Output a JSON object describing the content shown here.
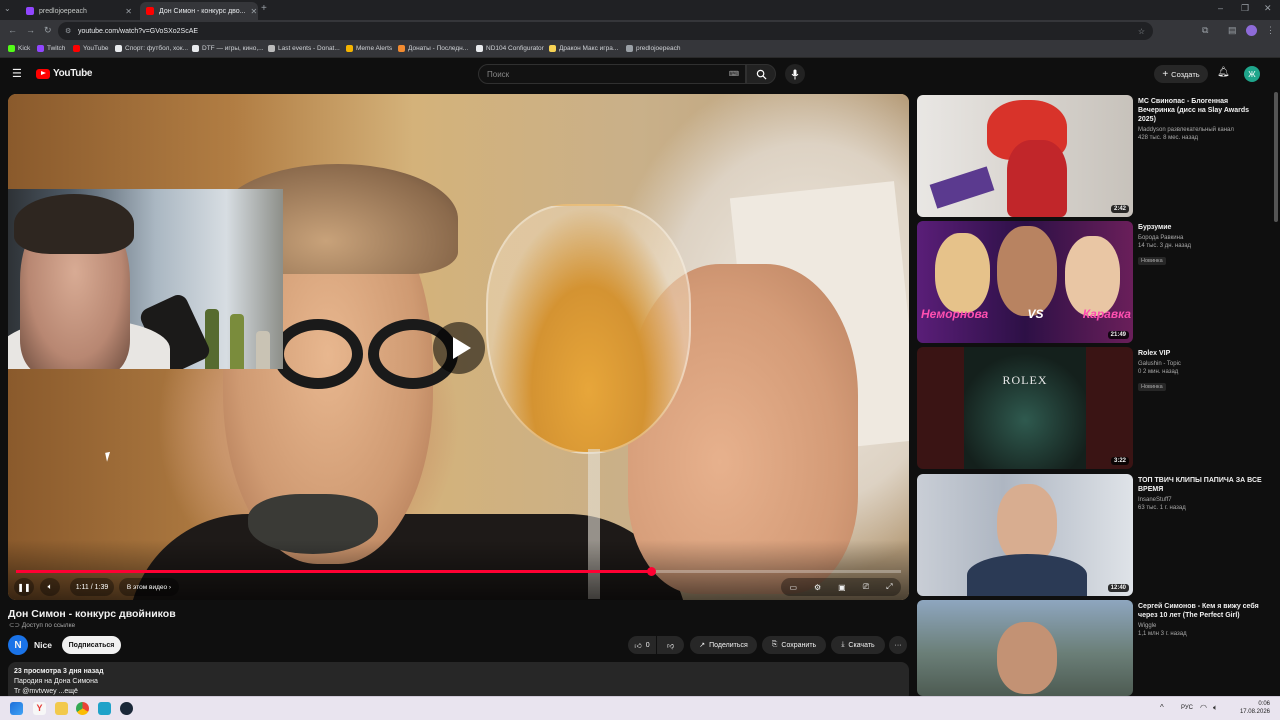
{
  "browser": {
    "tabs": [
      {
        "title": "predlojoepeach",
        "active": false
      },
      {
        "title": "Дон Симон - конкурс дво...",
        "active": true
      }
    ],
    "url": "youtube.com/watch?v=GVoSXo2ScAE",
    "bookmarks": [
      "Kick",
      "Twitch",
      "YouTube",
      "Спорт: футбол, хок...",
      "DTF — игры, кино,...",
      "Last events - Donat...",
      "Meme Alerts",
      "Донаты - Последн...",
      "ND104 Configurator",
      "Дракон Макс игра...",
      "predlojoepeach"
    ]
  },
  "youtube": {
    "logo_text": "YouTube",
    "search_placeholder": "Поиск",
    "create_label": "Создать",
    "user_initial": "Ж"
  },
  "player": {
    "time": "1:11 / 1:39",
    "chapter_label": "В этом видео",
    "progress": 0.718
  },
  "video": {
    "title": "Дон Симон - конкурс двойников",
    "access": "Доступ по ссылке",
    "channel_initial": "N",
    "channel": "Nice",
    "subscribe": "Подписаться",
    "likes": "0",
    "share": "Поделиться",
    "save": "Сохранить",
    "download": "Скачать",
    "more": "···",
    "stats": "23 просмотра  3 дня назад",
    "desc_line1": "Пародия на Дона Симона",
    "desc_line2": "Tr @mvtvwey ...ещё"
  },
  "recommendations": [
    {
      "title": "МС Свинопас - Блогенная Вечеринка (дисс на Slay Awards 2025)",
      "channel": "Maddyson развлекательный канал",
      "meta": "428 тыс.  8 мес. назад",
      "badge": "",
      "duration": "2:42"
    },
    {
      "title": "Бурзумие",
      "channel": "Борода Равкина",
      "meta": "14 тыс.  3 дн. назад",
      "badge": "Новинка",
      "duration": "21:49"
    },
    {
      "title": "Rolex VIP",
      "channel": "Galushin - Topic",
      "meta": "0  2 мин. назад",
      "badge": "Новинка",
      "duration": "3:22"
    },
    {
      "title": "ТОП ТВИЧ КЛИПЫ ПАПИЧА ЗА ВСЕ ВРЕМЯ",
      "channel": "InsaneStuff7",
      "meta": "63 тыс.  1 г. назад",
      "badge": "",
      "duration": "12:40"
    },
    {
      "title": "Сергей Симонов - Кем я вижу себя через 10 лет (The Perfect Girl)",
      "channel": "Wiggle",
      "meta": "1,1 млн  3 г. назад",
      "badge": "",
      "duration": ""
    }
  ],
  "thumb_text": {
    "rec2_left": "Неморнова",
    "rec2_vs": "VS",
    "rec2_right": "Каравка",
    "rec3_brand": "ROLEX"
  },
  "taskbar": {
    "lang": "РУС",
    "time": "0:06",
    "date": "17.08.2026"
  }
}
